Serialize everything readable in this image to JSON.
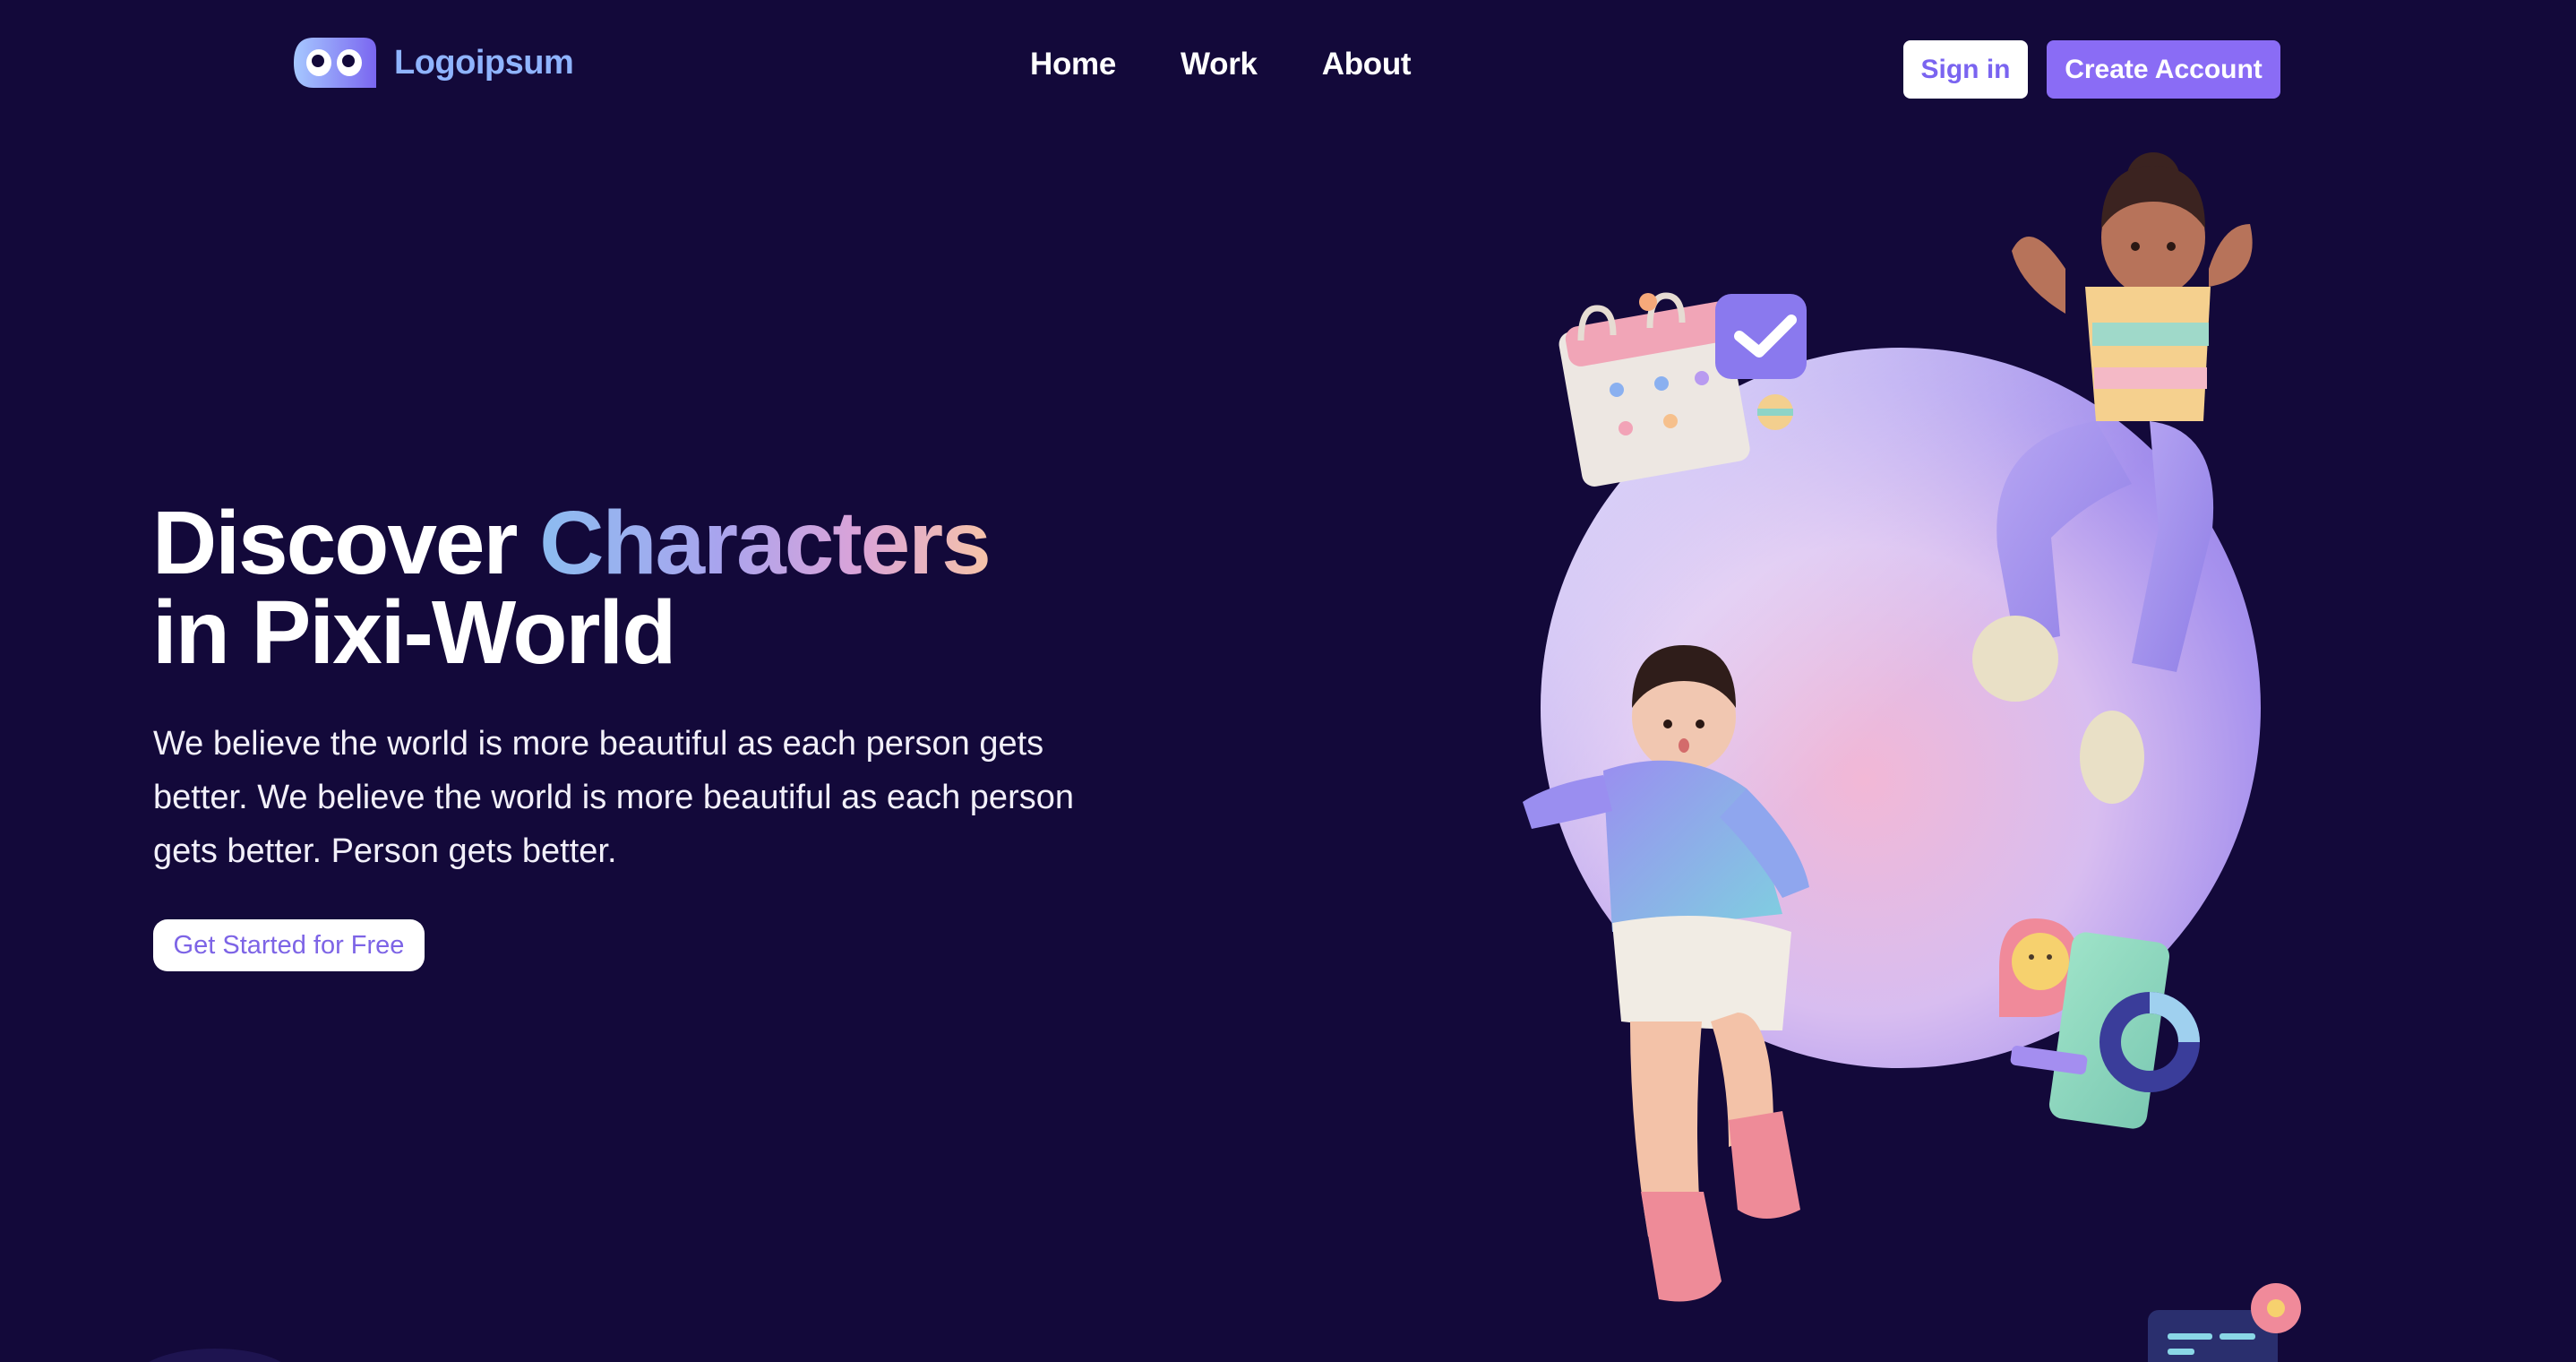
{
  "header": {
    "logo_text": "Logoipsum",
    "nav": [
      {
        "label": "Home"
      },
      {
        "label": "Work"
      },
      {
        "label": "About"
      }
    ],
    "signin_label": "Sign in",
    "create_label": "Create Account"
  },
  "hero": {
    "title_part1": "Discover ",
    "title_highlight": "Characters",
    "title_line2": "in Pixi-World",
    "description": "We believe the world is more beautiful as each person gets better. We believe the world is more beautiful as each person gets better. Person gets better.",
    "cta_label": "Get Started for Free"
  },
  "colors": {
    "background": "#13093a",
    "accent": "#8a6cf5",
    "logo_text": "#8fb4ff",
    "white": "#ffffff"
  },
  "icons": [
    "logo-eyes-icon",
    "calendar-icon",
    "check-badge-icon",
    "smiley-chat-icon",
    "chart-phone-icon",
    "message-card-icon"
  ]
}
